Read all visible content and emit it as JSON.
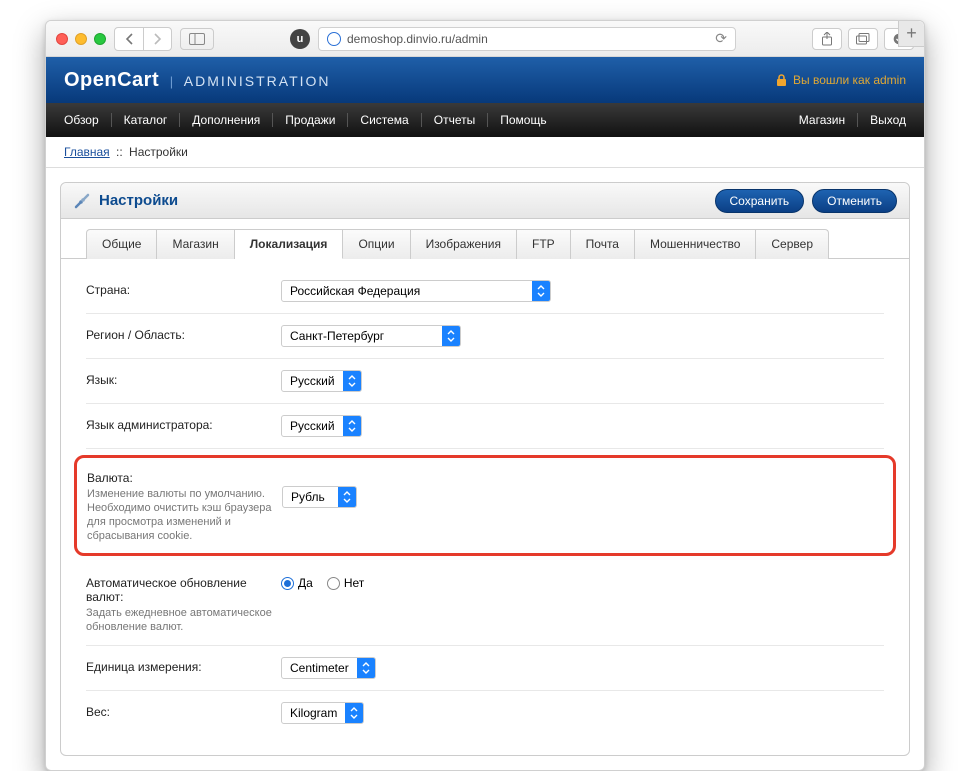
{
  "browser": {
    "url": "demoshop.dinvio.ru/admin"
  },
  "header": {
    "logo": "OpenCart",
    "admin_label": "ADMINISTRATION",
    "login_text": "Вы вошли как admin"
  },
  "menu": {
    "items": [
      "Обзор",
      "Каталог",
      "Дополнения",
      "Продажи",
      "Система",
      "Отчеты",
      "Помощь"
    ],
    "right": [
      "Магазин",
      "Выход"
    ]
  },
  "breadcrumb": {
    "home": "Главная",
    "current": "Настройки",
    "sep": "::"
  },
  "panel": {
    "title": "Настройки",
    "save": "Сохранить",
    "cancel": "Отменить"
  },
  "tabs": [
    "Общие",
    "Магазин",
    "Локализация",
    "Опции",
    "Изображения",
    "FTP",
    "Почта",
    "Мошенничество",
    "Сервер"
  ],
  "form": {
    "country_label": "Страна:",
    "country_value": "Российская Федерация",
    "region_label": "Регион / Область:",
    "region_value": "Санкт-Петербург",
    "language_label": "Язык:",
    "language_value": "Русский",
    "admin_language_label": "Язык администратора:",
    "admin_language_value": "Русский",
    "currency_label": "Валюта:",
    "currency_sub": "Изменение валюты по умолчанию. Необходимо очистить кэш браузера для просмотра изменений и сбрасывания cookie.",
    "currency_value": "Рубль",
    "auto_update_label": "Автоматическое обновление валют:",
    "auto_update_sub": "Задать ежедневное автоматическое обновление валют.",
    "auto_yes": "Да",
    "auto_no": "Нет",
    "unit_label": "Единица измерения:",
    "unit_value": "Centimeter",
    "weight_label": "Вес:",
    "weight_value": "Kilogram"
  }
}
